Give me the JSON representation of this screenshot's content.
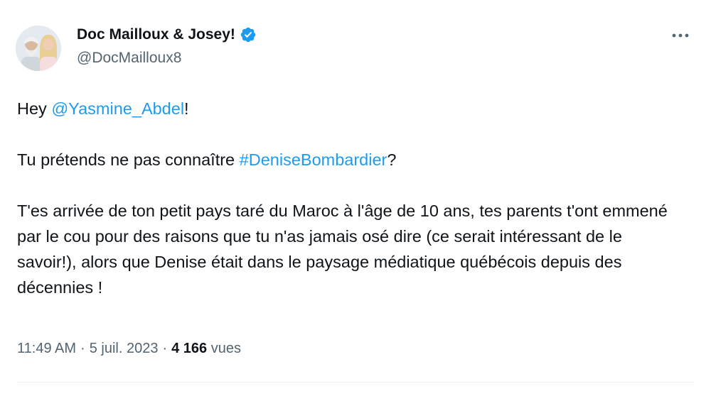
{
  "author": {
    "display_name": "Doc Mailloux & Josey!",
    "handle": "@DocMailloux8",
    "verified_icon": "verified-badge-icon",
    "verified_color": "#1d9bf0"
  },
  "tweet": {
    "line1_prefix": "Hey ",
    "line1_mention": "@Yasmine_Abdel",
    "line1_suffix": "!",
    "line2_prefix": "Tu prétends ne pas connaître ",
    "line2_hashtag": "#DeniseBombardier",
    "line2_suffix": "?",
    "line3": "T'es arrivée de ton petit pays taré du Maroc à l'âge de 10 ans, tes parents t'ont emmené par le cou pour des raisons que tu n'as jamais osé dire (ce serait intéressant de le savoir!), alors que Denise était dans le paysage médiatique québécois depuis des décennies !"
  },
  "meta": {
    "time": "11:49 AM",
    "date": "5 juil. 2023",
    "views_count": "4 166",
    "views_label": "vues",
    "separator": "·"
  },
  "colors": {
    "link": "#1d9bf0",
    "text": "#0f1419",
    "secondary": "#536471"
  }
}
